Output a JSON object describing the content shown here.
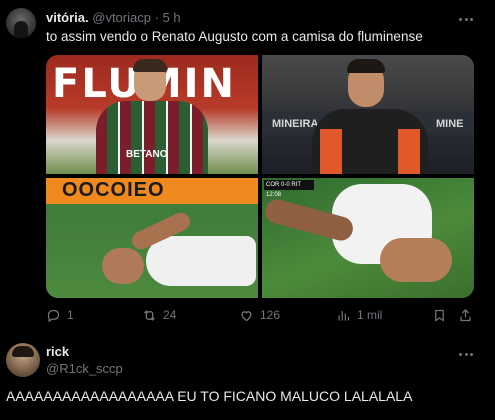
{
  "tweet1": {
    "display_name": "vitória.",
    "handle": "@vtoriacp",
    "separator": "·",
    "time": "5 h",
    "text": "to assim vendo o Renato Augusto com a camisa do fluminense",
    "more_icon": "more-horizontal-icon",
    "media": {
      "tile1": {
        "sign_text": "FLUMIN",
        "sponsor_text": "BETANO"
      },
      "tile2": {
        "sign_left": "MINEIRA",
        "sign_right": "MINE"
      },
      "tile3": {
        "ad_text": "OOCOIEO"
      },
      "tile4": {
        "scorebug_text": "COR 0-0 RIT 12:08"
      }
    },
    "actions": {
      "replies": "1",
      "retweets": "24",
      "likes": "126",
      "views": "1 mil"
    }
  },
  "tweet2": {
    "display_name": "rick",
    "handle": "@R1ck_sccp",
    "text": "AAAAAAAAAAAAAAAAAA EU TO FICANO MALUCO LALALALA",
    "more_icon": "more-horizontal-icon"
  },
  "colors": {
    "background": "#000000",
    "text": "#e7e9ea",
    "muted": "#71767b"
  }
}
